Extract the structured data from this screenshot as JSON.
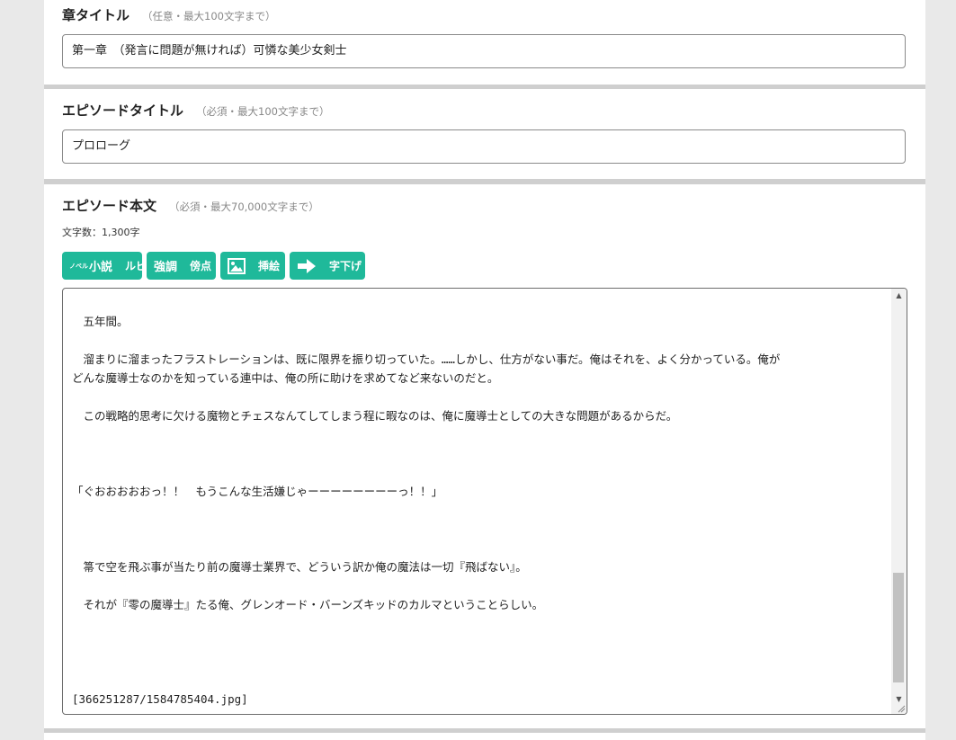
{
  "chapter": {
    "label": "章タイトル",
    "hint": "（任意・最大100文字まで）",
    "value": "第一章　（発言に問題が無ければ）可憐な美少女剣士"
  },
  "episode_title": {
    "label": "エピソードタイトル",
    "hint": "（必須・最大100文字まで）",
    "value": "プロローグ"
  },
  "episode_body": {
    "label": "エピソード本文",
    "hint": "（必須・最大70,000文字まで）",
    "char_count": "文字数：1,300字",
    "toolbar": {
      "ruby_small": "ノベル",
      "ruby_icon": "小説",
      "ruby_label": "ルビ",
      "emphasis_icon": "強調",
      "emphasis_label": "傍点",
      "illustration_label": "挿絵",
      "indent_label": "字下げ"
    },
    "lines": [
      "",
      "　五年間。",
      "",
      "　溜まりに溜まったフラストレーションは、既に限界を振り切っていた。……しかし、仕方がない事だ。俺はそれを、よく分かっている。俺が",
      "どんな魔導士なのかを知っている連中は、俺の所に助けを求めてなど来ないのだと。",
      "",
      "　この戦略的思考に欠ける魔物とチェスなんてしてしまう程に暇なのは、俺に魔導士としての大きな問題があるからだ。",
      "",
      "",
      "",
      "「ぐおおおおおっ！！　もうこんな生活嫌じゃーーーーーーーーっ！！」",
      "",
      "",
      "",
      "　箒で空を飛ぶ事が当たり前の魔導士業界で、どういう訳か俺の魔法は一切『飛ばない』。",
      "",
      "　それが『零の魔導士』たる俺、グレンオード・バーンズキッドのカルマということらしい。",
      "",
      "",
      "",
      "",
      "[366251287/1584785404.jpg]"
    ]
  }
}
